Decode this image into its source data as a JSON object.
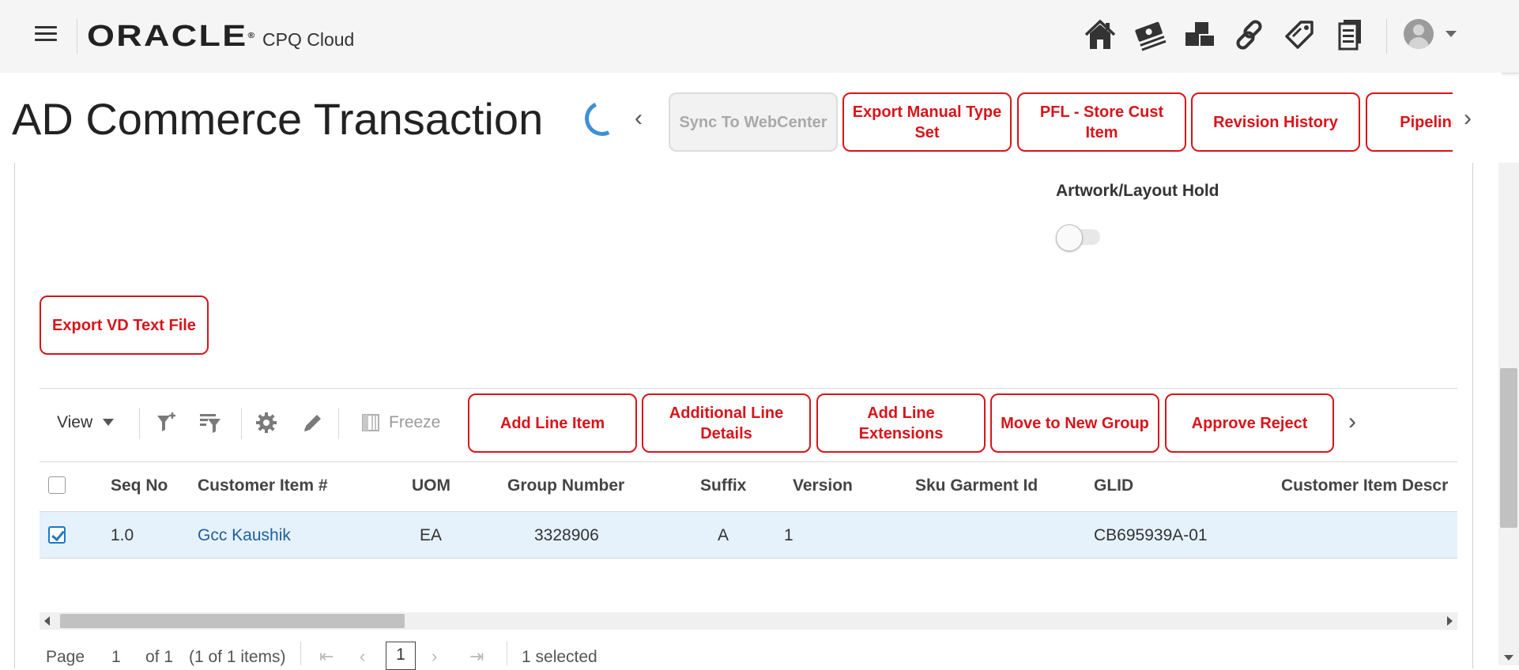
{
  "header": {
    "brand": "ORACLE",
    "brand_mark": "®",
    "product": "CPQ Cloud",
    "nav_icons": [
      "home-icon",
      "pricing-icon",
      "products-icon",
      "links-icon",
      "tag-icon",
      "documents-icon"
    ]
  },
  "title": {
    "text": "AD Commerce Transaction",
    "actions": [
      {
        "label": "Sync To WebCenter",
        "disabled": true
      },
      {
        "label": "Export Manual Type Set",
        "disabled": false
      },
      {
        "label": "PFL - Store Cust Item",
        "disabled": false
      },
      {
        "label": "Revision History",
        "disabled": false
      },
      {
        "label": "Pipeline View",
        "disabled": false
      }
    ]
  },
  "form": {
    "artwork_label": "Artwork/Layout Hold",
    "artwork_toggle_on": false,
    "export_vd_label": "Export VD Text File"
  },
  "toolbar": {
    "view_label": "View",
    "freeze_label": "Freeze",
    "buttons": [
      "Add Line Item",
      "Additional Line Details",
      "Add Line Extensions",
      "Move to New Group",
      "Approve Reject"
    ]
  },
  "table": {
    "columns": [
      "Seq No",
      "Customer Item #",
      "UOM",
      "Group Number",
      "Suffix",
      "Version",
      "Sku Garment Id",
      "GLID",
      "Customer Item Descr"
    ],
    "rows": [
      {
        "selected": true,
        "seq": "1.0",
        "customer_item": "Gcc Kaushik",
        "uom": "EA",
        "group_number": "3328906",
        "suffix": "A",
        "version": "1",
        "sku_garment_id": "",
        "glid": "CB695939A-01",
        "description": ""
      }
    ]
  },
  "pager": {
    "page_label": "Page",
    "page_value": "1",
    "of_label": "of 1",
    "items_label": "(1 of 1 items)",
    "current_page": "1",
    "selected_label": "1 selected"
  },
  "colors": {
    "accent_red": "#d9141a",
    "link_blue": "#1f5f9f",
    "selected_row": "#e5f1fb",
    "spinner_blue": "#3d90d6"
  }
}
